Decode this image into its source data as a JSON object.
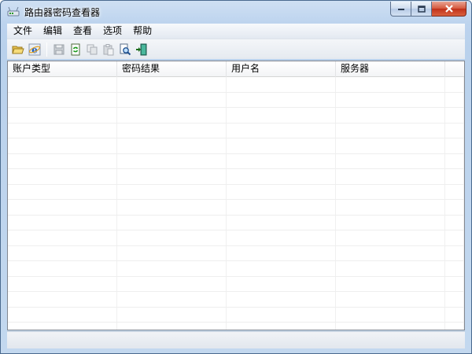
{
  "window": {
    "title": "路由器密码查看器"
  },
  "menu": {
    "items": [
      "文件",
      "编辑",
      "查看",
      "选项",
      "帮助"
    ]
  },
  "toolbar": {
    "buttons": [
      {
        "icon": "open-folder-icon",
        "enabled": true
      },
      {
        "icon": "ie-icon",
        "enabled": true
      },
      {
        "icon": "save-icon",
        "enabled": false
      },
      {
        "icon": "refresh-icon",
        "enabled": true
      },
      {
        "icon": "copy-icon",
        "enabled": false
      },
      {
        "icon": "paste-icon",
        "enabled": false
      },
      {
        "icon": "find-icon",
        "enabled": true
      },
      {
        "icon": "exit-icon",
        "enabled": true
      }
    ]
  },
  "list": {
    "columns": [
      "账户类型",
      "密码结果",
      "用户名",
      "服务器"
    ],
    "rows": []
  },
  "status": {
    "text": ""
  }
}
